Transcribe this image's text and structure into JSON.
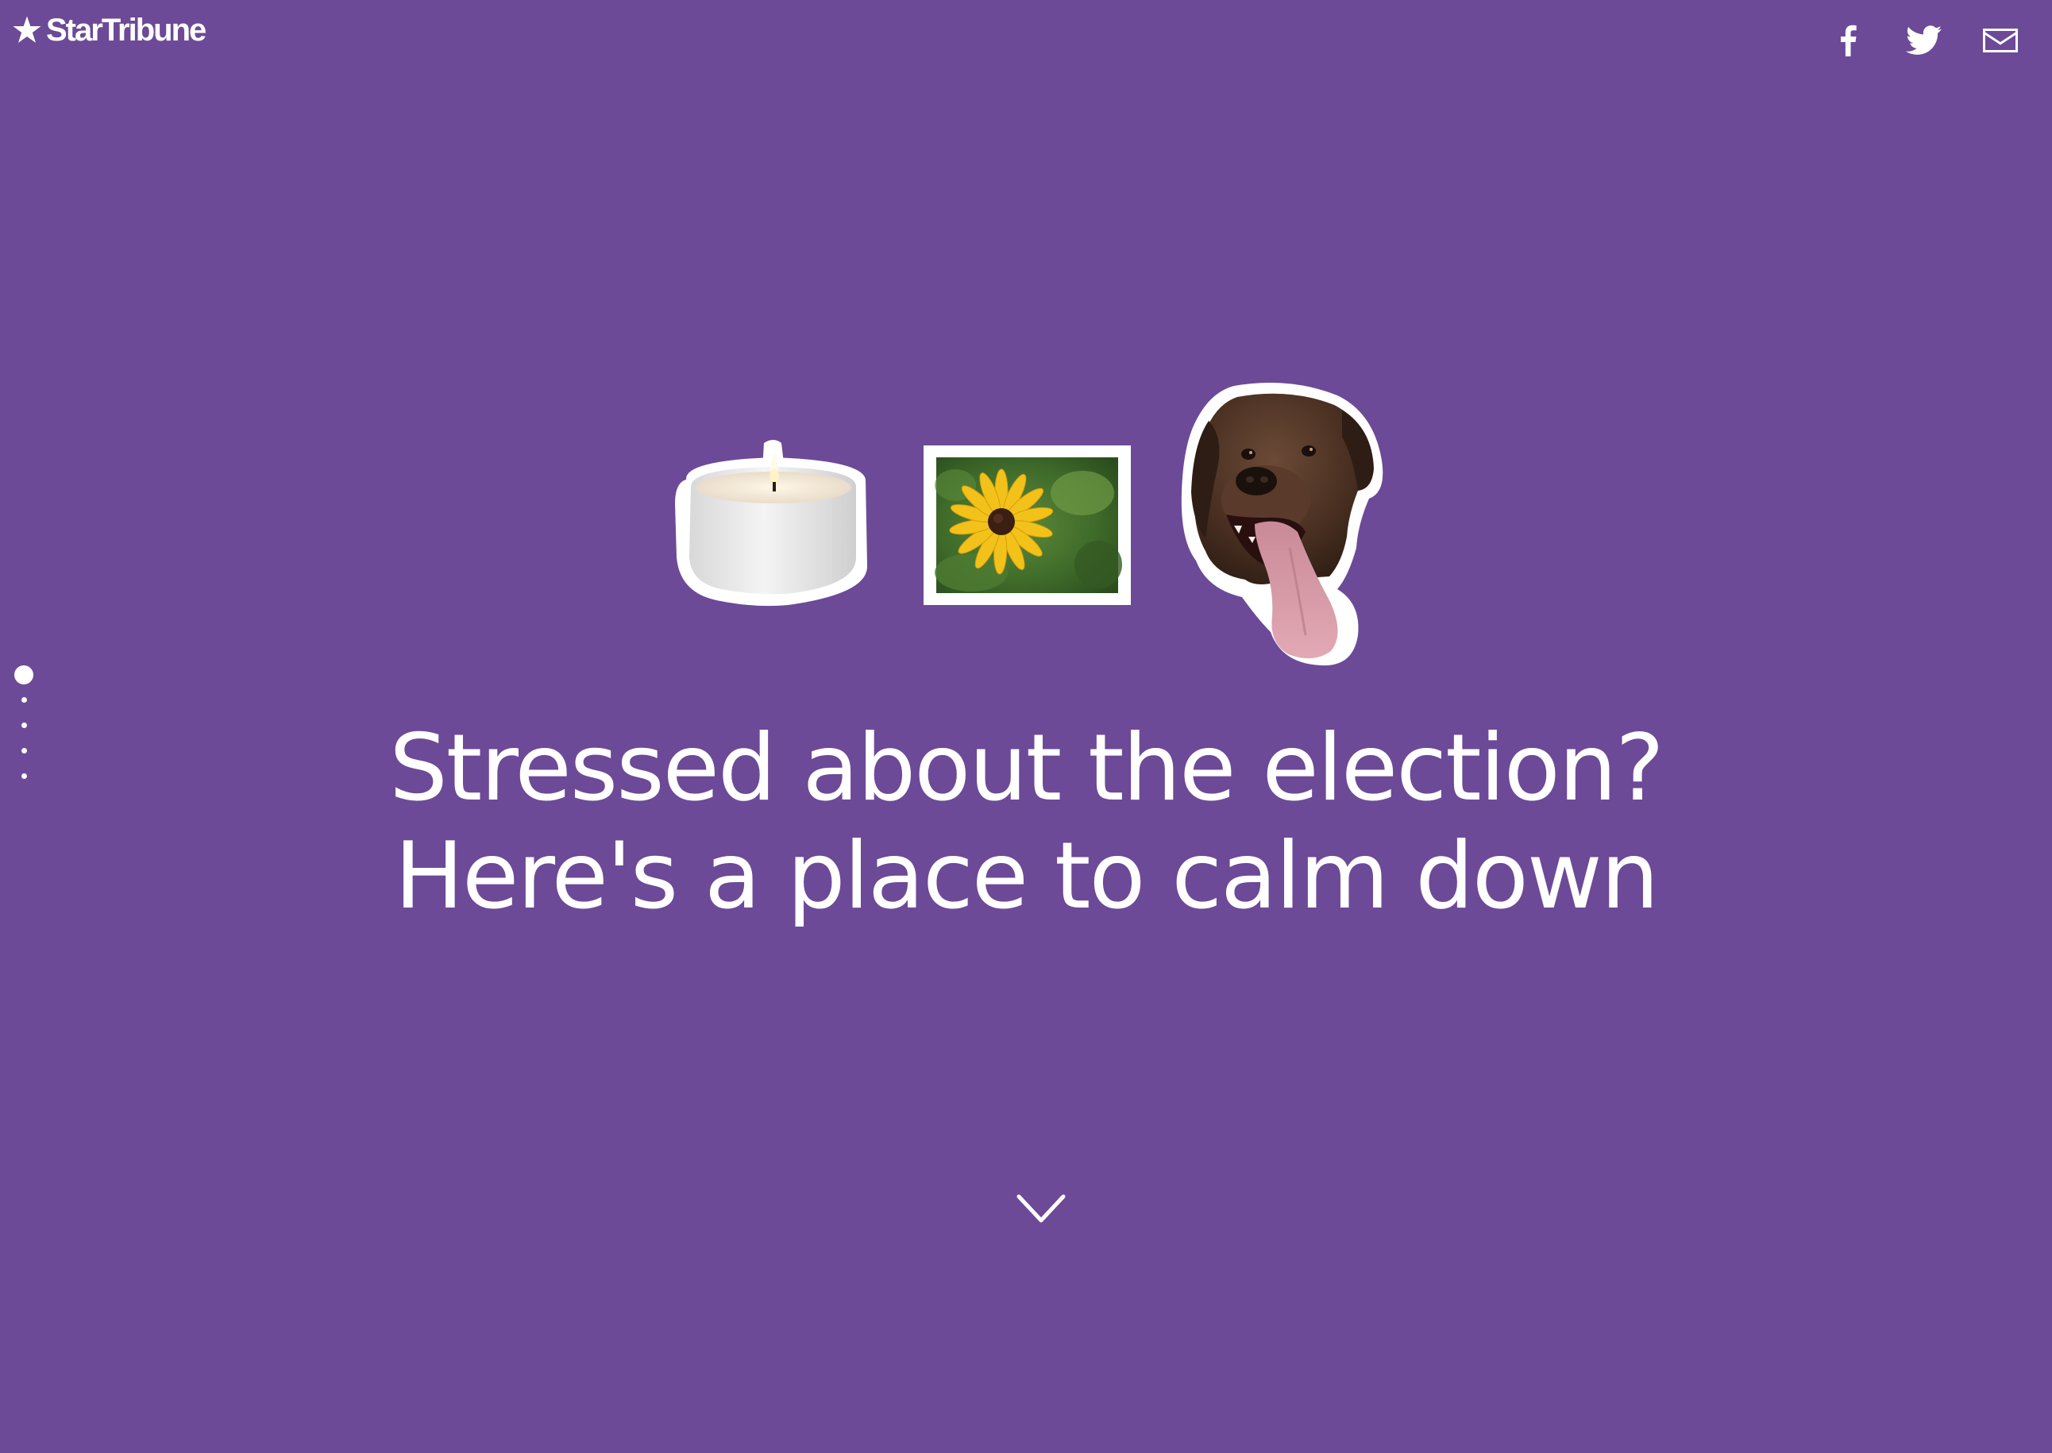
{
  "brand": {
    "name": "StarTribune",
    "logo_icon": "star-icon"
  },
  "share": {
    "items": [
      {
        "name": "facebook",
        "icon": "facebook-icon"
      },
      {
        "name": "twitter",
        "icon": "twitter-icon"
      },
      {
        "name": "email",
        "icon": "mail-icon"
      }
    ]
  },
  "side_nav": {
    "count": 5,
    "active_index": 0
  },
  "hero": {
    "images": [
      "candle",
      "black-eyed susan flower",
      "dog with tongue out"
    ],
    "headline_line1": "Stressed about the election?",
    "headline_line2": "Here's a place to calm down"
  },
  "scroll": {
    "icon": "chevron-down-icon"
  },
  "colors": {
    "background": "#6c4a97",
    "text": "#ffffff"
  }
}
